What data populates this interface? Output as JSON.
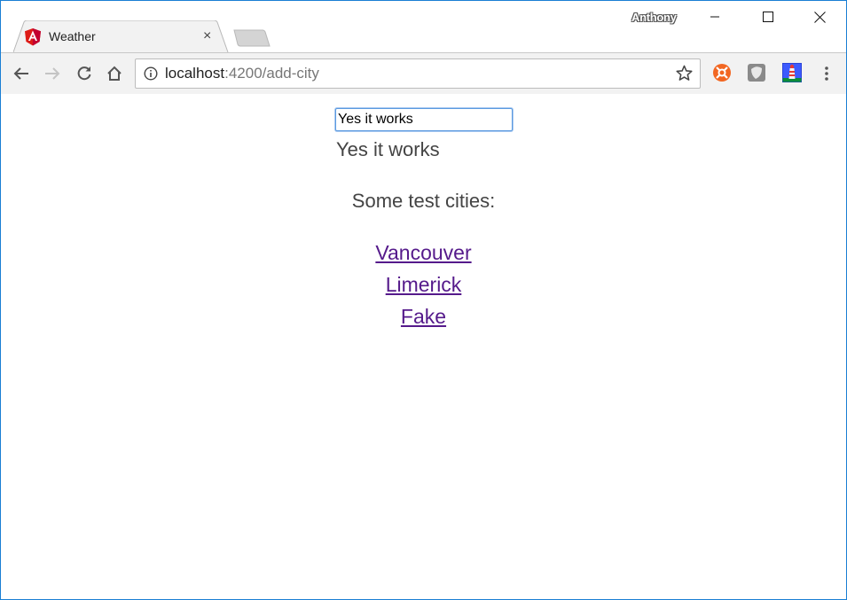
{
  "browser": {
    "tab": {
      "title": "Weather",
      "icon": "angular-icon",
      "close": "×"
    },
    "profile_name": "Anthony",
    "window_controls": {
      "minimize": "minimize-icon",
      "maximize": "maximize-icon",
      "close": "close-icon"
    },
    "address_bar": {
      "host": "localhost",
      "path": ":4200/add-city"
    },
    "extensions": [
      "orange-lifebuoy-extension-icon",
      "gray-shield-extension-icon",
      "lighthouse-extension-icon"
    ]
  },
  "page": {
    "input": {
      "value": "Yes it works"
    },
    "echo_text": "Yes it works",
    "heading": "Some test cities:",
    "cities": [
      {
        "label": "Vancouver"
      },
      {
        "label": "Limerick"
      },
      {
        "label": "Fake"
      }
    ]
  },
  "colors": {
    "link": "#551a8b",
    "window_border": "#1a7fd4",
    "angular_red": "#dd1b16"
  }
}
